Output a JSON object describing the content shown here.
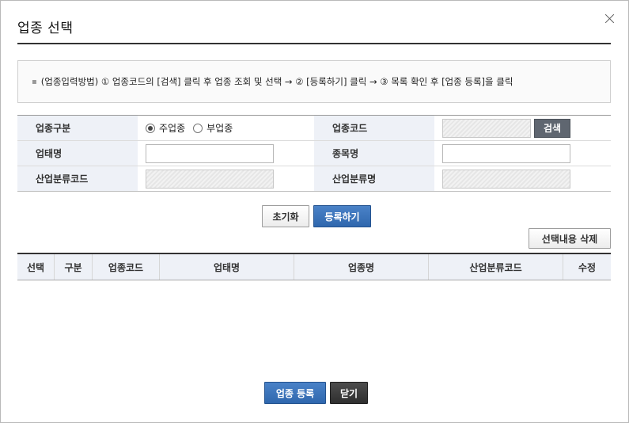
{
  "dialog": {
    "title": "업종 선택"
  },
  "notice": {
    "text": "(업종입력방법) ① 업종코드의 [검색] 클릭 후 업종 조회 및 선택 → ② [등록하기] 클릭 → ③ 목록 확인 후 [업종 등록]을 클릭"
  },
  "form": {
    "business_type_label": "업종구분",
    "radio_main": "주업종",
    "radio_sub": "부업종",
    "radio_selected": "주업종",
    "business_code_label": "업종코드",
    "business_code_value": "",
    "search_label": "검색",
    "business_category_label": "업태명",
    "business_category_value": "",
    "item_name_label": "종목명",
    "item_name_value": "",
    "industry_code_label": "산업분류코드",
    "industry_code_value": "",
    "industry_name_label": "산업분류명",
    "industry_name_value": ""
  },
  "actions": {
    "reset_label": "초기화",
    "register_label": "등록하기",
    "delete_selected_label": "선택내용 삭제"
  },
  "grid": {
    "columns": [
      "선택",
      "구분",
      "업종코드",
      "업태명",
      "업종명",
      "산업분류코드",
      "수정"
    ],
    "rows": []
  },
  "footer": {
    "submit_label": "업종 등록",
    "close_label": "닫기"
  }
}
